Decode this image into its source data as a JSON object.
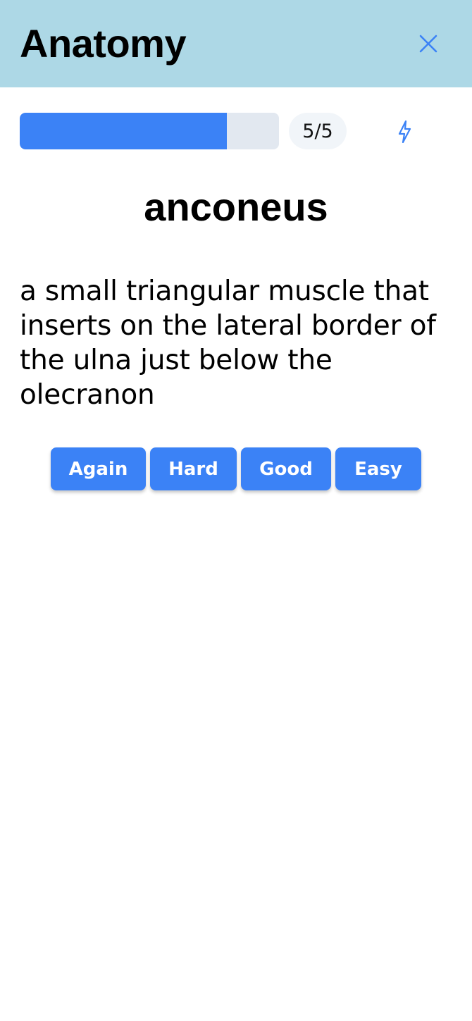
{
  "header": {
    "title": "Anatomy",
    "close_icon": "close-icon",
    "background_color": "#add8e6"
  },
  "progress": {
    "fraction": 0.8,
    "counter": "5/5",
    "bolt_icon": "lightning-bolt-icon",
    "fill_color": "#3b82f6",
    "track_color": "#e2e8f0"
  },
  "card": {
    "term": "anconeus",
    "definition": "a small triangular muscle that inserts on the lateral border of the ulna just below the olecranon"
  },
  "rating_buttons": [
    {
      "label": "Again"
    },
    {
      "label": "Hard"
    },
    {
      "label": "Good"
    },
    {
      "label": "Easy"
    }
  ],
  "accent_color": "#3b82f6"
}
